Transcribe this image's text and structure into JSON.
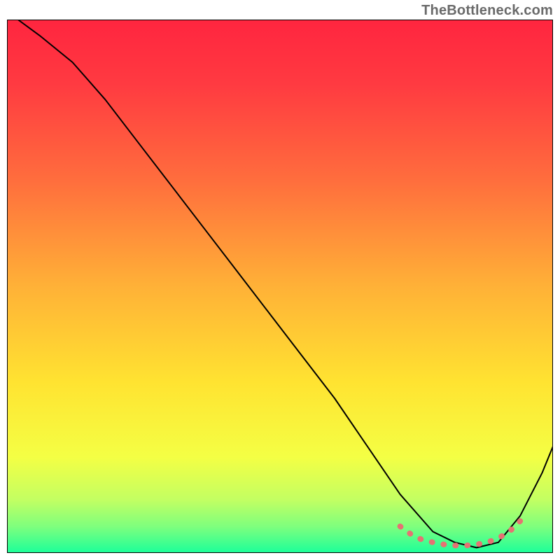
{
  "watermark": "TheBottleneck.com",
  "chart_data": {
    "type": "line",
    "title": "",
    "xlabel": "",
    "ylabel": "",
    "xlim": [
      0,
      100
    ],
    "ylim": [
      0,
      100
    ],
    "grid": false,
    "legend": false,
    "gradient_fill": {
      "stops": [
        {
          "offset": 0.0,
          "color": "#ff253f"
        },
        {
          "offset": 0.12,
          "color": "#ff3a41"
        },
        {
          "offset": 0.3,
          "color": "#ff6d3d"
        },
        {
          "offset": 0.5,
          "color": "#ffb137"
        },
        {
          "offset": 0.68,
          "color": "#ffe331"
        },
        {
          "offset": 0.82,
          "color": "#f4ff44"
        },
        {
          "offset": 0.9,
          "color": "#c3ff62"
        },
        {
          "offset": 0.95,
          "color": "#7fff7d"
        },
        {
          "offset": 1.0,
          "color": "#1bff9a"
        }
      ]
    },
    "series": [
      {
        "name": "curve",
        "color": "#000000",
        "stroke_width": 2,
        "x": [
          2,
          6,
          12,
          18,
          24,
          30,
          36,
          42,
          48,
          54,
          60,
          66,
          72,
          78,
          82,
          86,
          90,
          94,
          98,
          100
        ],
        "y": [
          100,
          97,
          92,
          85,
          77,
          69,
          61,
          53,
          45,
          37,
          29,
          20,
          11,
          4,
          2,
          1,
          2,
          7,
          15,
          20
        ]
      },
      {
        "name": "bottom-highlight",
        "type": "scatter",
        "style": "dotted-thick",
        "color": "#e57373",
        "stroke_width": 8,
        "x": [
          72,
          74,
          76,
          78,
          80,
          82,
          84,
          86,
          88,
          90,
          92,
          94
        ],
        "y": [
          5,
          3.5,
          2.5,
          2,
          1.6,
          1.4,
          1.4,
          1.6,
          2,
          2.8,
          4,
          6
        ]
      }
    ]
  }
}
